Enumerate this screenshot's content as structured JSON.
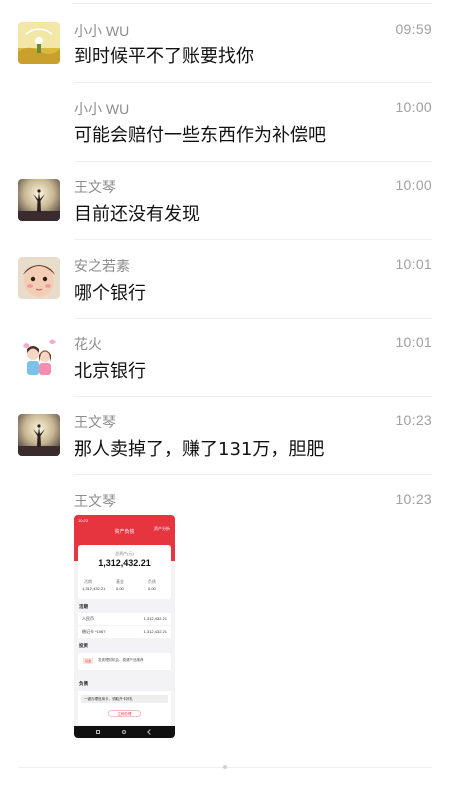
{
  "messages": [
    {
      "name": "小小 WU",
      "time": "09:59",
      "text": "到时候平不了账要找你",
      "avatar": "field-scenery"
    },
    {
      "name": "小小 WU",
      "time": "10:00",
      "text": "可能会赔付一些东西作为补偿吧",
      "avatar": ""
    },
    {
      "name": "王文琴",
      "time": "10:00",
      "text": "目前还没有发现",
      "avatar": "silhouette-sunset"
    },
    {
      "name": "安之若素",
      "time": "10:01",
      "text": "哪个银行",
      "avatar": "child-portrait"
    },
    {
      "name": "花火",
      "time": "10:01",
      "text": "北京银行",
      "avatar": "cartoon-couple"
    },
    {
      "name": "王文琴",
      "time": "10:23",
      "text": "那人卖掉了，赚了131万，胆肥",
      "avatar": "silhouette-sunset"
    },
    {
      "name": "王文琴",
      "time": "10:23",
      "text": "",
      "avatar": ""
    }
  ],
  "screenshot": {
    "status_time": "10:23",
    "title": "资产负债",
    "corner_label": "资产分析",
    "total_caption": "总资产(元)",
    "total_amount": "1,312,432.21",
    "stats": [
      {
        "label": "活期",
        "value": "1,312,432.21"
      },
      {
        "label": "基金",
        "value": "0.00"
      },
      {
        "label": "负债",
        "value": "0.00"
      }
    ],
    "section_deposit": "活期",
    "rows": [
      {
        "label": "人民币",
        "value": "1,312,432.21"
      },
      {
        "label": "借记卡 *1067",
        "value": "1,312,432.21"
      }
    ],
    "section_invest": "投资",
    "invest_badge": "基金",
    "invest_text": "发现理财机会，稳健产品推荐",
    "section_debt": "负债",
    "loan_text": "一键办理信用卡，领取开卡好礼",
    "loan_button": "立即办理"
  },
  "colors": {
    "accent": "#e6353f"
  }
}
